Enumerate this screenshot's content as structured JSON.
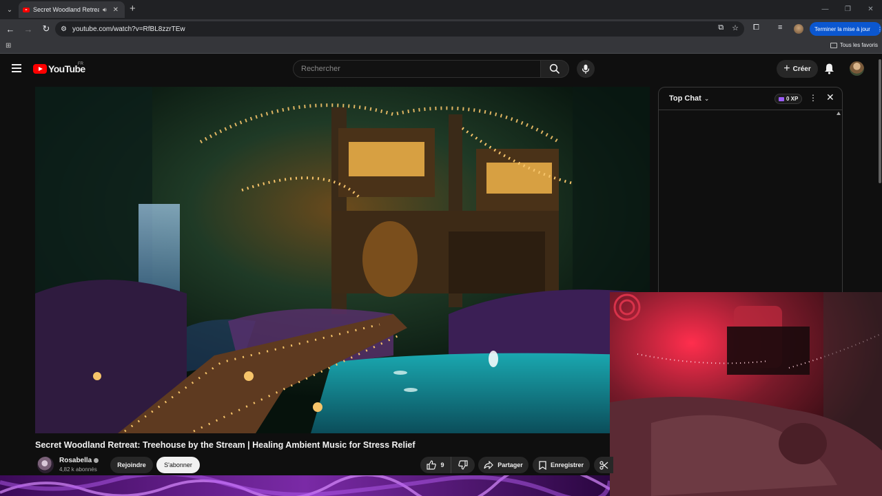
{
  "browser": {
    "tab_title": "Secret Woodland Retreat: T",
    "url": "youtube.com/watch?v=RfBL8zzrTEw",
    "update_label": "Terminer la mise à jour",
    "bookmarks_label": "Tous les favoris"
  },
  "youtube": {
    "logo_text": "YouTube",
    "country_code": "FR",
    "search_placeholder": "Rechercher",
    "create_label": "Créer"
  },
  "chat": {
    "title": "Top Chat",
    "xp_label": "0 XP"
  },
  "video": {
    "title": "Secret Woodland Retreat: Treehouse by the Stream | Healing Ambient Music for Stress Relief",
    "channel_name": "Rosabella",
    "subscribers": "4,82 k abonnés",
    "join_label": "Rejoindre",
    "subscribe_label": "S'abonner",
    "likes": "9",
    "share_label": "Partager",
    "save_label": "Enregistrer"
  },
  "icons": [
    "tab-search-icon",
    "audio-icon",
    "close-icon",
    "new-tab-icon",
    "minimize-icon",
    "maximize-icon",
    "window-close-icon",
    "back-icon",
    "forward-icon",
    "reload-icon",
    "site-info-icon",
    "install-app-icon",
    "star-icon",
    "extensions-icon",
    "media-icon",
    "kebab-icon",
    "apps-icon",
    "folder-icon",
    "hamburger-icon",
    "search-icon",
    "mic-icon",
    "plus-icon",
    "bell-icon",
    "like-icon",
    "dislike-icon",
    "share-icon",
    "save-icon",
    "clip-icon"
  ],
  "colors": {
    "youtube_red": "#ff0000",
    "update_button": "#0b57d0",
    "xp_gem": "#9b5cf6"
  }
}
